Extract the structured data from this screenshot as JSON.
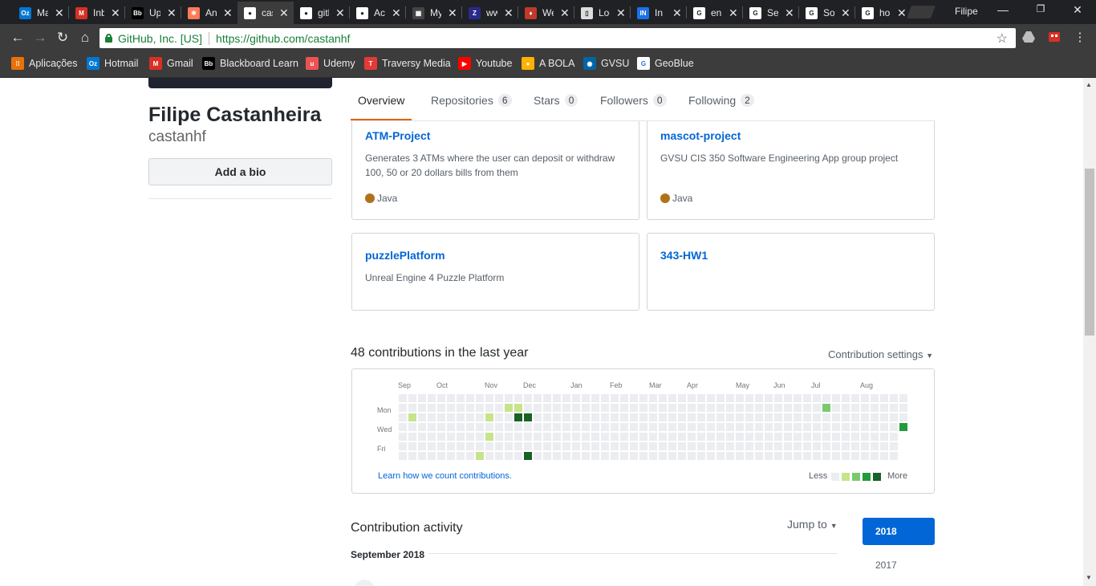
{
  "browser": {
    "tabs": [
      {
        "title": "Mail",
        "icon": "outlook-icon",
        "color": "#0078d4",
        "glyph": "Oz"
      },
      {
        "title": "Inbox",
        "icon": "gmail-icon",
        "color": "#d93025",
        "glyph": "M"
      },
      {
        "title": "Upload",
        "icon": "blackboard-icon",
        "color": "#000000",
        "glyph": "Bb"
      },
      {
        "title": "Analytics",
        "icon": "hubspot-icon",
        "color": "#ff7a59",
        "glyph": "✻"
      },
      {
        "title": "castanhf",
        "icon": "github-icon",
        "color": "#ffffff",
        "glyph": "●"
      },
      {
        "title": "github",
        "icon": "github-icon",
        "color": "#ffffff",
        "glyph": "●"
      },
      {
        "title": "Account",
        "icon": "github-icon",
        "color": "#ffffff",
        "glyph": "●"
      },
      {
        "title": "My",
        "icon": "my-icon",
        "color": "#444444",
        "glyph": "▦"
      },
      {
        "title": "www",
        "icon": "wiki-icon",
        "color": "#2a2a8a",
        "glyph": "Z"
      },
      {
        "title": "Web",
        "icon": "web-icon",
        "color": "#c0392b",
        "glyph": "♦"
      },
      {
        "title": "Local",
        "icon": "document-icon",
        "color": "#dddddd",
        "glyph": "▯"
      },
      {
        "title": "In",
        "icon": "in-icon",
        "color": "#1a73e8",
        "glyph": "IN"
      },
      {
        "title": "en",
        "icon": "google-icon",
        "color": "#ffffff",
        "glyph": "G"
      },
      {
        "title": "Se",
        "icon": "google-icon",
        "color": "#ffffff",
        "glyph": "G"
      },
      {
        "title": "So",
        "icon": "google-icon",
        "color": "#ffffff",
        "glyph": "G"
      },
      {
        "title": "ho",
        "icon": "google-icon",
        "color": "#ffffff",
        "glyph": "G"
      }
    ],
    "profile": "Filipe",
    "secure_label": "GitHub, Inc. [US]",
    "url": "https://github.com/castanhf",
    "bookmarks": [
      {
        "label": "Aplicações",
        "icon": "apps-grid-icon",
        "color": "#e8710a",
        "glyph": "⁞⁞"
      },
      {
        "label": "Hotmail",
        "icon": "outlook-icon",
        "color": "#0078d4",
        "glyph": "Oz"
      },
      {
        "label": "Gmail",
        "icon": "gmail-icon",
        "color": "#d93025",
        "glyph": "M"
      },
      {
        "label": "Blackboard Learn",
        "icon": "blackboard-icon",
        "color": "#000000",
        "glyph": "Bb"
      },
      {
        "label": "Udemy",
        "icon": "udemy-icon",
        "color": "#ec5252",
        "glyph": "u"
      },
      {
        "label": "Traversy Media",
        "icon": "traversy-icon",
        "color": "#e53935",
        "glyph": "T"
      },
      {
        "label": "Youtube",
        "icon": "youtube-icon",
        "color": "#ff0000",
        "glyph": "▶"
      },
      {
        "label": "A BOLA",
        "icon": "abola-icon",
        "color": "#ffb300",
        "glyph": "●"
      },
      {
        "label": "GVSU",
        "icon": "gvsu-icon",
        "color": "#0065a4",
        "glyph": "◉"
      },
      {
        "label": "GeoBlue",
        "icon": "geoblue-icon",
        "color": "#ffffff",
        "glyph": "G"
      }
    ]
  },
  "profile": {
    "full_name": "Filipe Castanheira",
    "username": "castanhf",
    "bio_button": "Add a bio"
  },
  "nav": {
    "tabs": [
      {
        "label": "Overview",
        "count": null
      },
      {
        "label": "Repositories",
        "count": "6"
      },
      {
        "label": "Stars",
        "count": "0"
      },
      {
        "label": "Followers",
        "count": "0"
      },
      {
        "label": "Following",
        "count": "2"
      }
    ]
  },
  "repos": [
    {
      "name": "ATM-Project",
      "desc": "Generates 3 ATMs where the user can deposit or withdraw 100, 50 or 20 dollars bills from them",
      "lang": "Java"
    },
    {
      "name": "mascot-project",
      "desc": "GVSU CIS 350 Software Engineering App group project",
      "lang": "Java"
    },
    {
      "name": "puzzlePlatform",
      "desc": "Unreal Engine 4 Puzzle Platform",
      "lang": ""
    },
    {
      "name": "343-HW1",
      "desc": "",
      "lang": ""
    }
  ],
  "contributions": {
    "title": "48 contributions in the last year",
    "settings": "Contribution settings",
    "months": [
      "Sep",
      "Oct",
      "Nov",
      "Dec",
      "Jan",
      "Feb",
      "Mar",
      "Apr",
      "May",
      "Jun",
      "Jul",
      "Aug"
    ],
    "days": [
      "Mon",
      "Wed",
      "Fri"
    ],
    "learn_link": "Learn how we count contributions.",
    "less": "Less",
    "more": "More",
    "palette": [
      "#ebedf0",
      "#c6e48b",
      "#7bc96f",
      "#239a3b",
      "#196127"
    ]
  },
  "activity": {
    "title": "Contribution activity",
    "jump_to": "Jump to",
    "month_heading": "September 2018",
    "years": [
      "2018",
      "2017"
    ]
  }
}
